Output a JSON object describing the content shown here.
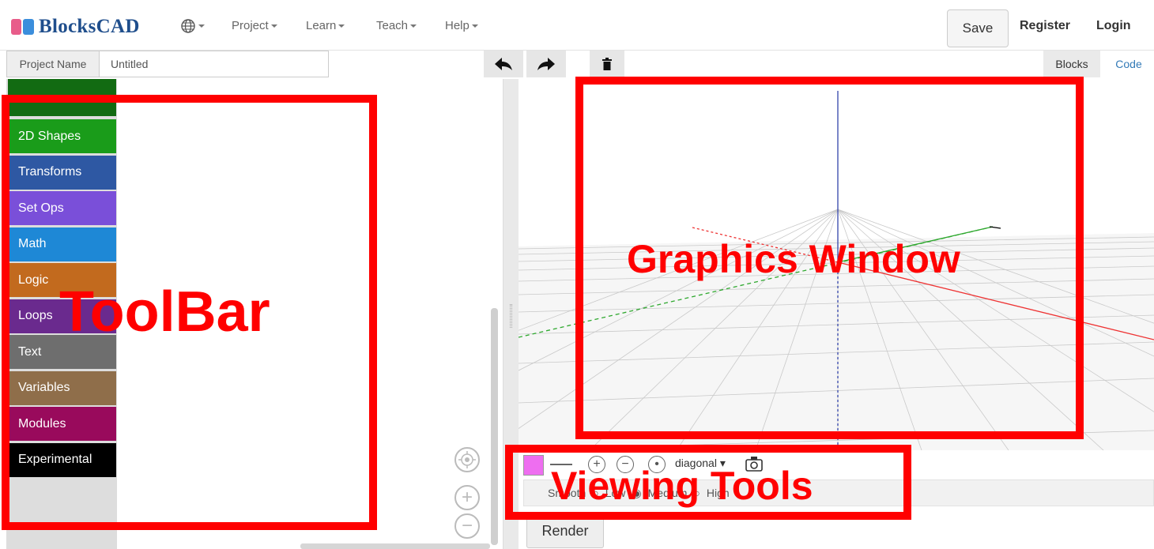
{
  "header": {
    "brand": "BlocksCAD",
    "nav": {
      "project": "Project",
      "learn": "Learn",
      "teach": "Teach",
      "help": "Help"
    },
    "save_label": "Save",
    "register_label": "Register",
    "login_label": "Login"
  },
  "project": {
    "name_label": "Project Name",
    "name_value": "Untitled"
  },
  "tabs": {
    "blocks": "Blocks",
    "code": "Code"
  },
  "toolbox": {
    "categories": [
      {
        "label": "2D Shapes",
        "color": "#1a9c1a"
      },
      {
        "label": "Transforms",
        "color": "#2e58a3"
      },
      {
        "label": "Set Ops",
        "color": "#7a4fd9"
      },
      {
        "label": "Math",
        "color": "#1e88d6"
      },
      {
        "label": "Logic",
        "color": "#c26a1e"
      },
      {
        "label": "Loops",
        "color": "#6a2a8e"
      },
      {
        "label": "Text",
        "color": "#6e6e6e"
      },
      {
        "label": "Variables",
        "color": "#8f6e4a"
      },
      {
        "label": "Modules",
        "color": "#990a5c"
      },
      {
        "label": "Experimental",
        "color": "#000000"
      }
    ],
    "top_partial_color": "#126b12"
  },
  "view_tools": {
    "view_option": "diagonal",
    "render_label": "Render",
    "smooth_label": "Smooth",
    "res_low": "Low",
    "res_medium": "Medium",
    "res_high": "High",
    "swatch_color": "#ee6ef0"
  },
  "annotations": {
    "toolbar": "ToolBar",
    "graphics": "Graphics Window",
    "viewing": "Viewing Tools",
    "color": "#ff0000"
  }
}
